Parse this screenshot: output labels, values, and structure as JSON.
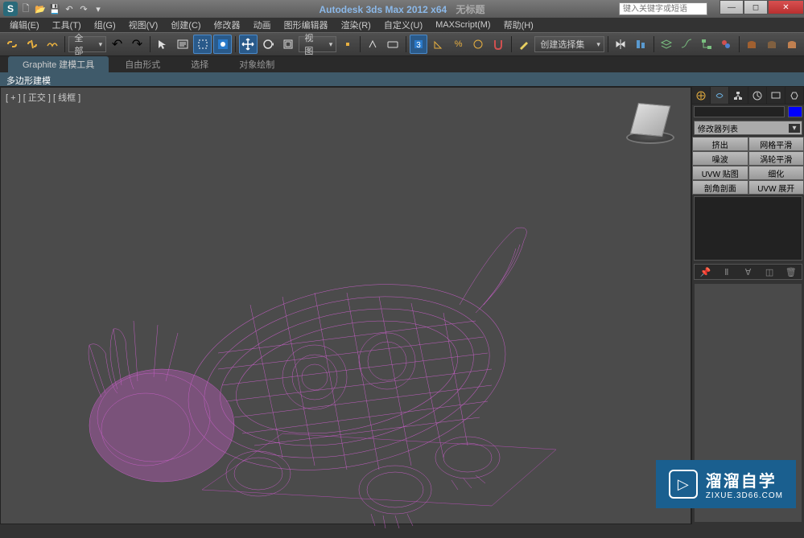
{
  "titlebar": {
    "app_name": "Autodesk 3ds Max  2012 x64",
    "doc_name": "无标题",
    "search_placeholder": "键入关键字或短语"
  },
  "menubar": {
    "items": [
      "编辑(E)",
      "工具(T)",
      "组(G)",
      "视图(V)",
      "创建(C)",
      "修改器",
      "动画",
      "图形编辑器",
      "渲染(R)",
      "自定义(U)",
      "MAXScript(M)",
      "帮助(H)"
    ]
  },
  "toolbar": {
    "scope_label": "全部",
    "view_label": "视图",
    "selection_label": "创建选择集"
  },
  "ribbon": {
    "tabs": [
      "Graphite 建模工具",
      "自由形式",
      "选择",
      "对象绘制"
    ],
    "subtitle": "多边形建模"
  },
  "viewport": {
    "label": "[ + ] [ 正交 ] [ 线框 ]"
  },
  "command_panel": {
    "modifier_list_label": "修改器列表",
    "buttons": [
      [
        "挤出",
        "网格平滑"
      ],
      [
        "噪波",
        "涡轮平滑"
      ],
      [
        "UVW 贴图",
        "细化"
      ],
      [
        "剖角剖面",
        "UVW 展开"
      ]
    ],
    "stack_icons": [
      "📌",
      "Ⅱ",
      "∀",
      "◫",
      "🗑"
    ]
  },
  "watermark": {
    "title": "溜溜自学",
    "subtitle": "ZIXUE.3D66.COM"
  }
}
